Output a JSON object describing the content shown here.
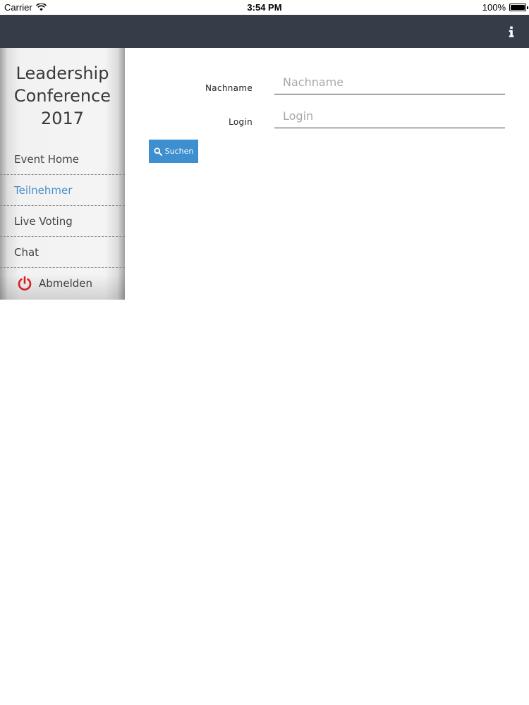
{
  "status_bar": {
    "carrier": "Carrier",
    "time": "3:54 PM",
    "battery": "100%"
  },
  "navbar": {
    "background": "#353e48",
    "info_icon": "info-icon"
  },
  "sidebar": {
    "event_title": "Leadership\nConference\n2017",
    "items": [
      {
        "label": "Event Home",
        "active": false
      },
      {
        "label": "Teilnehmer",
        "active": true
      },
      {
        "label": "Live Voting",
        "active": false
      },
      {
        "label": "Chat",
        "active": false
      }
    ],
    "logout": {
      "label": "Abmelden",
      "icon": "power-icon",
      "icon_color": "#e01f26"
    }
  },
  "form": {
    "lastname": {
      "label": "Nachname",
      "placeholder": "Nachname",
      "value": ""
    },
    "login": {
      "label": "Login",
      "placeholder": "Login",
      "value": ""
    },
    "search_button": {
      "label": "Suchen",
      "icon": "search-icon",
      "color": "#3d8fcf"
    }
  },
  "colors": {
    "accent": "#4a90c8",
    "navbar": "#353e48"
  }
}
